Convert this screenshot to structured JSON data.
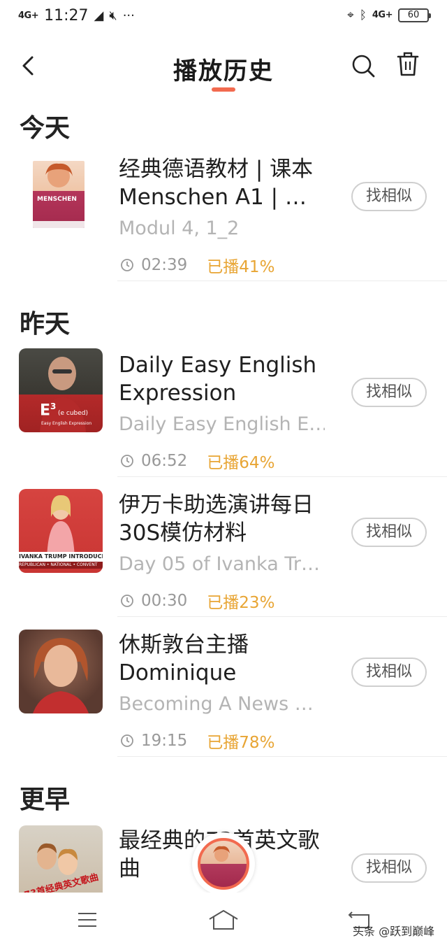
{
  "status_bar": {
    "signal_left": "4G+",
    "time": "11:27",
    "signal_right": "4G+",
    "battery": "60"
  },
  "header": {
    "title": "播放历史"
  },
  "sections": [
    {
      "title": "今天",
      "items": [
        {
          "title": "经典德语教材 | 课本 Menschen A1 | …",
          "subtitle": "Modul 4, 1_2",
          "duration": "02:39",
          "progress": "已播41%",
          "button": "找相似",
          "thumb_text": "MENSCHEN"
        }
      ]
    },
    {
      "title": "昨天",
      "items": [
        {
          "title": "Daily Easy English Expression",
          "subtitle": "Daily Easy English E…",
          "duration": "06:52",
          "progress": "已播64%",
          "button": "找相似",
          "thumb_text_1": "E",
          "thumb_text_2": "3",
          "thumb_text_3": "(e cubed)",
          "thumb_text_4": "Easy English Expression"
        },
        {
          "title": "伊万卡助选演讲每日30S模仿材料",
          "subtitle": "Day 05 of Ivanka Tr…",
          "duration": "00:30",
          "progress": "已播23%",
          "button": "找相似",
          "thumb_text_1": "IVANKA TRUMP INTRODUCING",
          "thumb_text_2": "REPUBLICAN • NATIONAL • CONVENT"
        },
        {
          "title": "休斯敦台主播 Dominique",
          "subtitle": "Becoming A News …",
          "duration": "19:15",
          "progress": "已播78%",
          "button": "找相似"
        }
      ]
    },
    {
      "title": "更早",
      "items": [
        {
          "title": "最经典的73首英文歌曲",
          "button": "找相似",
          "thumb_text": "73首经典英文歌曲"
        }
      ]
    }
  ],
  "watermark": "头条 @跃到巅峰",
  "colors": {
    "accent": "#f26a4f",
    "progress": "#e8a534",
    "subtitle": "#b4b4b4"
  },
  "icons": [
    "back-icon",
    "search-icon",
    "trash-icon",
    "clock-icon",
    "menu-icon",
    "home-icon",
    "return-icon"
  ]
}
